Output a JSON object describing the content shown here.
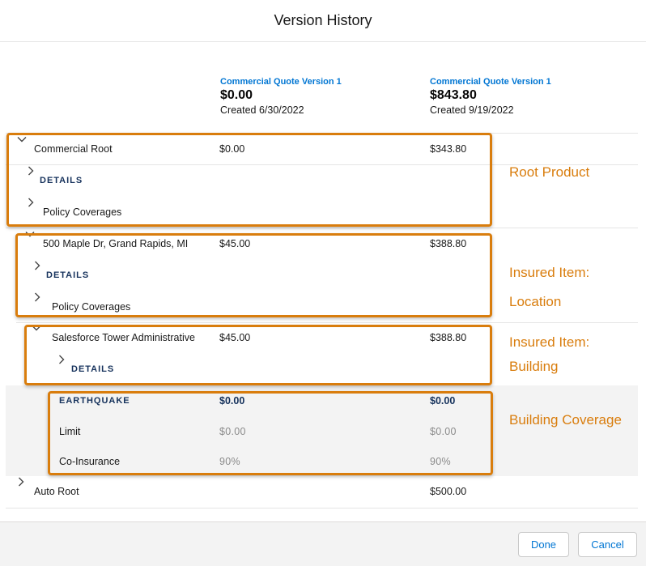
{
  "modal": {
    "title": "Version History"
  },
  "versions": [
    {
      "name": "Commercial Quote Version 1",
      "price": "$0.00",
      "created": "Created 6/30/2022"
    },
    {
      "name": "Commercial Quote Version 1",
      "price": "$843.80",
      "created": "Created 9/19/2022"
    }
  ],
  "rows": {
    "commercial_root": {
      "label": "Commercial Root",
      "v1": "$0.00",
      "v2": "$343.80"
    },
    "root_details": {
      "label": "DETAILS"
    },
    "root_policy": {
      "label": "Policy Coverages"
    },
    "location": {
      "label": "500 Maple Dr, Grand Rapids, MI",
      "v1": "$45.00",
      "v2": "$388.80"
    },
    "location_details": {
      "label": "DETAILS"
    },
    "location_policy": {
      "label": "Policy Coverages"
    },
    "building": {
      "label": "Salesforce Tower Administrative",
      "v1": "$45.00",
      "v2": "$388.80"
    },
    "building_details": {
      "label": "DETAILS"
    },
    "earthquake": {
      "label": "EARTHQUAKE",
      "v1": "$0.00",
      "v2": "$0.00"
    },
    "limit": {
      "label": "Limit",
      "v1": "$0.00",
      "v2": "$0.00"
    },
    "coinsurance": {
      "label": "Co-Insurance",
      "v1": "90%",
      "v2": "90%"
    },
    "auto_root": {
      "label": "Auto Root",
      "v2": "$500.00"
    }
  },
  "annotations": {
    "root_product": "Root Product",
    "location_line1": "Insured Item:",
    "location_line2": "Location",
    "building_line1": "Insured Item:",
    "building_line2": "Building",
    "building_coverage": "Building Coverage"
  },
  "footer": {
    "done_label": "Done",
    "cancel_label": "Cancel"
  },
  "colors": {
    "accent": "#0176d3",
    "annotation": "#d97d0d"
  }
}
